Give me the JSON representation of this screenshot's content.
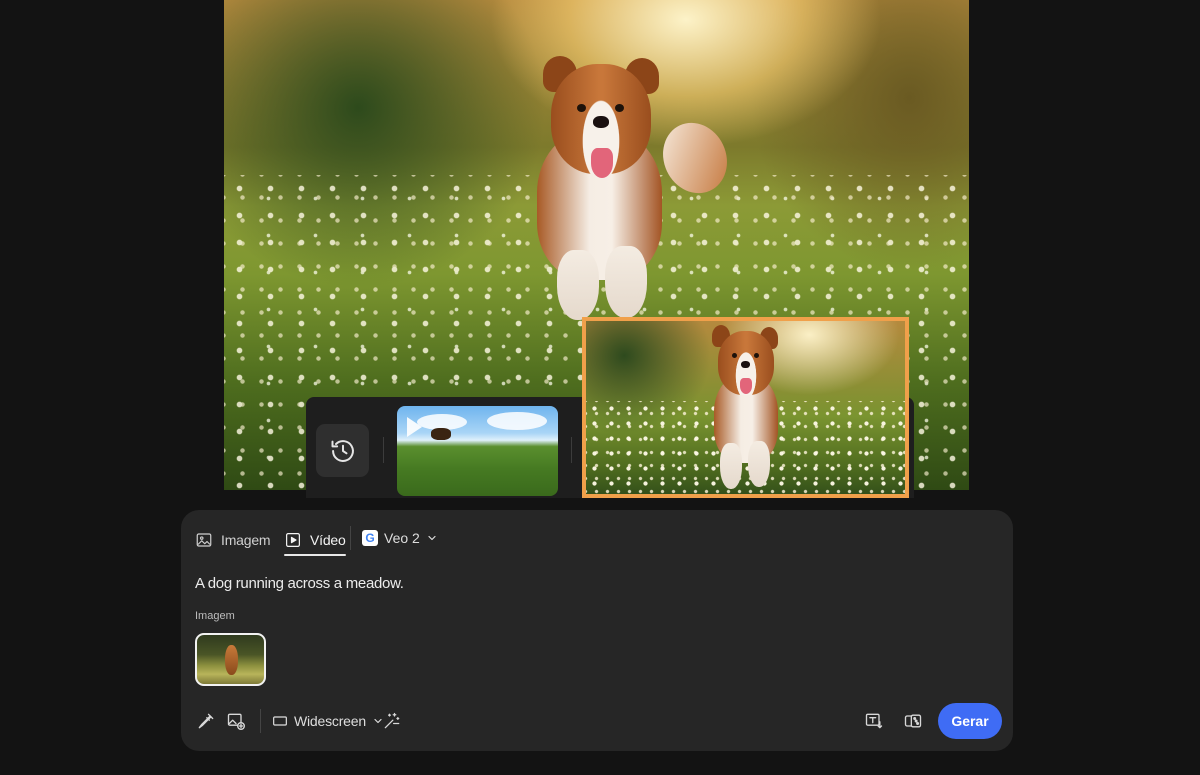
{
  "mode_tabs": [
    {
      "label": "Imagem",
      "icon": "image-icon",
      "active": false
    },
    {
      "label": "Vídeo",
      "icon": "video-icon",
      "active": true
    }
  ],
  "model": {
    "label": "Veo 2",
    "icon": "google-icon"
  },
  "prompt": {
    "value": "A dog running across a meadow."
  },
  "reference": {
    "label": "Imagem"
  },
  "toolbar": {
    "aspect_label": "Widescreen",
    "generate_label": "Gerar"
  },
  "icons": {
    "history": "history-icon",
    "eyedropper": "eyedropper-icon",
    "add_image": "add-image-icon",
    "aspect": "widescreen-icon",
    "effects": "sparkle-effects-icon",
    "style": "style-text-icon",
    "dice": "dice-icon"
  },
  "colors": {
    "accent": "#3f6cf5",
    "selection": "#f0a04a",
    "panel": "#262626",
    "background": "#131313"
  }
}
